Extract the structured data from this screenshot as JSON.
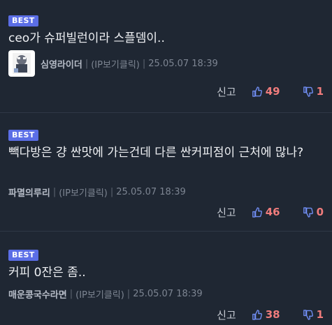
{
  "comments": [
    {
      "badge": "BEST",
      "text": "ceo가 슈퍼빌런이라 스플뎀이..",
      "author": "심영라이더",
      "ip_label": "(IP보기클릭)",
      "date": "25.05.07 18:39",
      "report_label": "신고",
      "likes": "49",
      "dislikes": "1",
      "has_avatar": true
    },
    {
      "badge": "BEST",
      "text": "빽다방은 걍 싼맛에 가는건데 다른 싼커피점이 근처에 많나?",
      "author": "파멸의루리",
      "ip_label": "(IP보기클릭)",
      "date": "25.05.07 18:39",
      "report_label": "신고",
      "likes": "46",
      "dislikes": "0",
      "has_avatar": false
    },
    {
      "badge": "BEST",
      "text": "커피 0잔은 좀..",
      "author": "매운콩국수라면",
      "ip_label": "(IP보기클릭)",
      "date": "25.05.07 18:39",
      "report_label": "신고",
      "likes": "38",
      "dislikes": "1",
      "has_avatar": false
    }
  ],
  "colors": {
    "background": "#1f2733",
    "badge": "#5b6ee6",
    "like_icon": "#6f8cf0",
    "count": "#f07c7c"
  },
  "icons": {
    "like": "thumbs-up-icon",
    "dislike": "thumbs-down-icon"
  }
}
